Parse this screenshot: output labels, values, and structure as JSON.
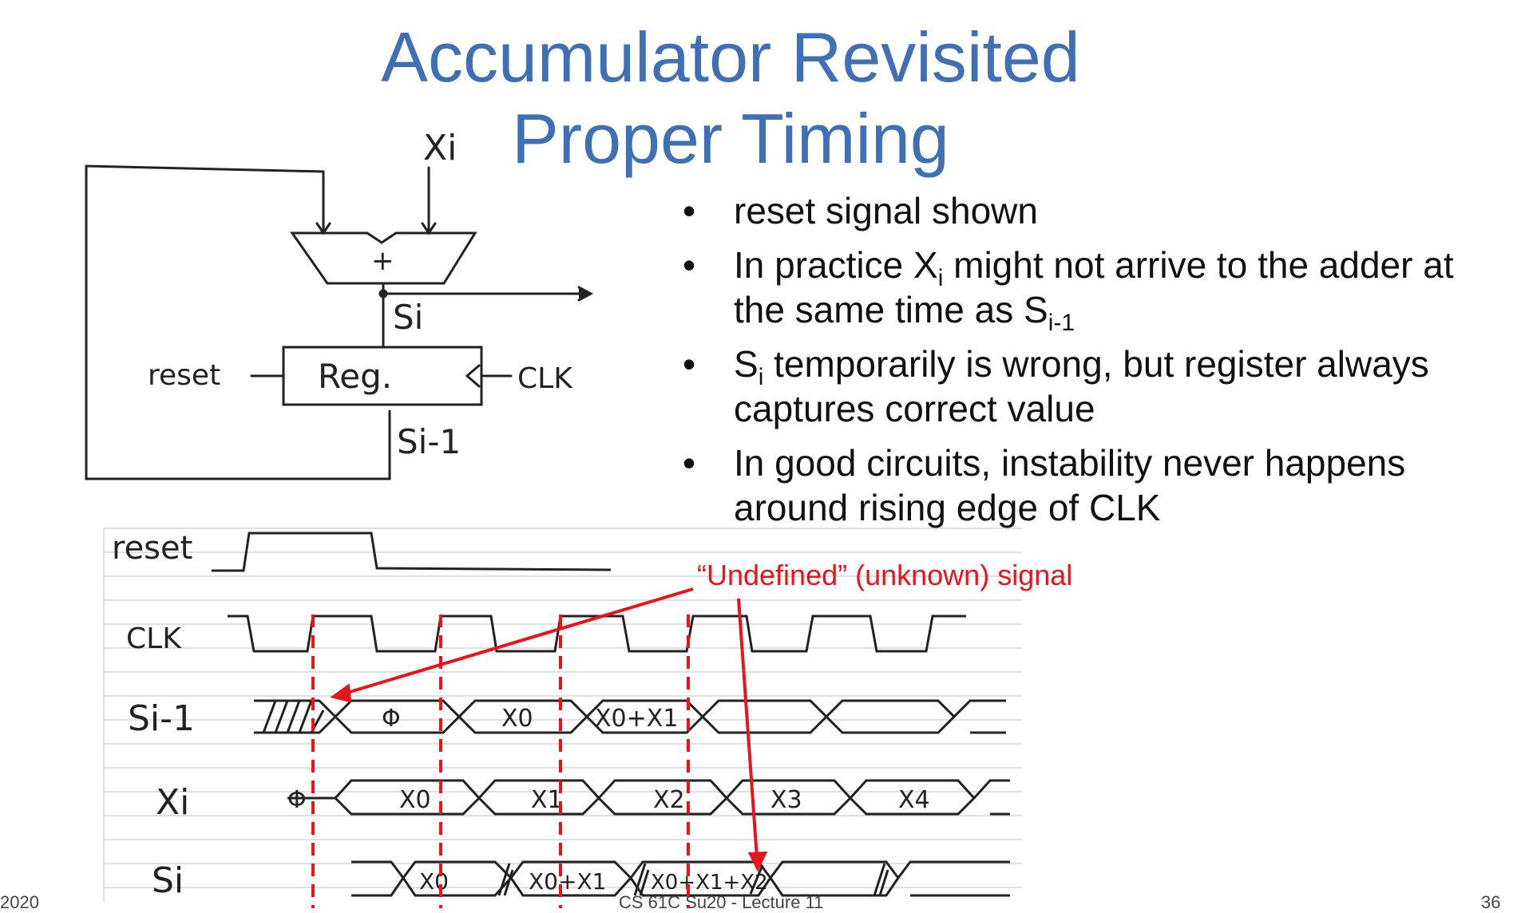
{
  "title": {
    "line1": "Accumulator Revisited",
    "line2": "Proper Timing"
  },
  "bullets": {
    "b1": "reset signal shown",
    "b2": {
      "pre": "In practice X",
      "sub1": "i",
      "mid": " might not arrive to the adder at the same time as S",
      "sub2": "i-1"
    },
    "b3": {
      "pre": "S",
      "sub1": "i",
      "post": " temporarily is wrong, but register always captures correct value"
    },
    "b4": "In good circuits, instability never happens around rising edge of CLK"
  },
  "annotation": {
    "text": "“Undefined” (unknown) signal",
    "color": "#e8141b"
  },
  "circuit": {
    "xi": "Xi",
    "plus": "+",
    "si": "Si",
    "reg": "Reg.",
    "reset": "reset",
    "clk": "CLK",
    "si1": "Si-1"
  },
  "timing": {
    "rows": {
      "reset": "reset",
      "clk": "CLK",
      "si1": "Si-1",
      "xi": "Xi",
      "si": "Si"
    },
    "si1_values": [
      "Φ",
      "X0",
      "X0+X1"
    ],
    "xi_values": [
      "Φ",
      "X0",
      "X1",
      "X2",
      "X3",
      "X4"
    ],
    "si_values": [
      "X0",
      "X0+X1",
      "X0+X1+X2"
    ]
  },
  "footer": {
    "left": "2020",
    "center": "CS 61C Su20 - Lecture 11",
    "right": "36"
  },
  "colors": {
    "title": "#3f6fb5",
    "red": "#e8141b"
  }
}
